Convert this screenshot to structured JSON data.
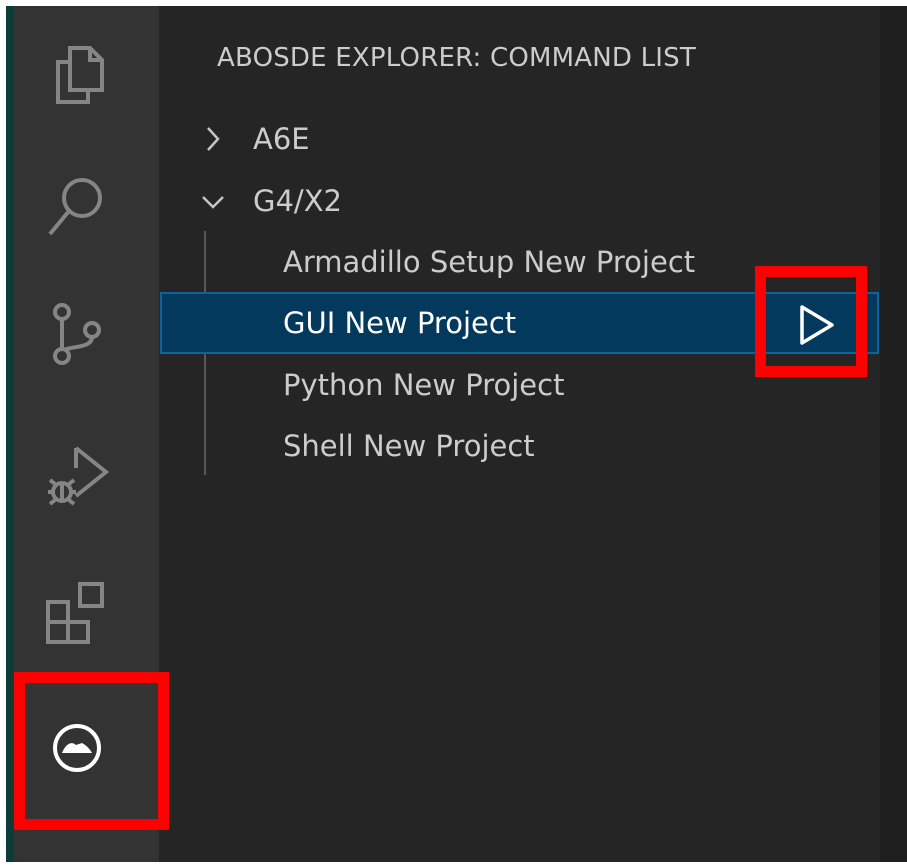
{
  "colors": {
    "activity_bar_bg": "#333333",
    "side_bar_bg": "#252526",
    "selection_bg": "#04395e",
    "selection_border": "#0e639c",
    "highlight": "#ff0000",
    "text": "#cccccc"
  },
  "activity_bar": {
    "items": [
      {
        "icon": "explorer-icon"
      },
      {
        "icon": "search-icon"
      },
      {
        "icon": "source-control-icon"
      },
      {
        "icon": "run-debug-icon"
      },
      {
        "icon": "extensions-icon"
      },
      {
        "icon": "abosde-icon",
        "active": true
      }
    ]
  },
  "sidebar": {
    "title": "ABOSDE EXPLORER: COMMAND LIST",
    "tree": [
      {
        "label": "A6E",
        "expanded": false
      },
      {
        "label": "G4/X2",
        "expanded": true,
        "children": [
          {
            "label": "Armadillo Setup New Project"
          },
          {
            "label": "GUI New Project",
            "selected": true,
            "action_icon": "run-icon"
          },
          {
            "label": "Python New Project"
          },
          {
            "label": "Shell New Project"
          }
        ]
      }
    ]
  }
}
